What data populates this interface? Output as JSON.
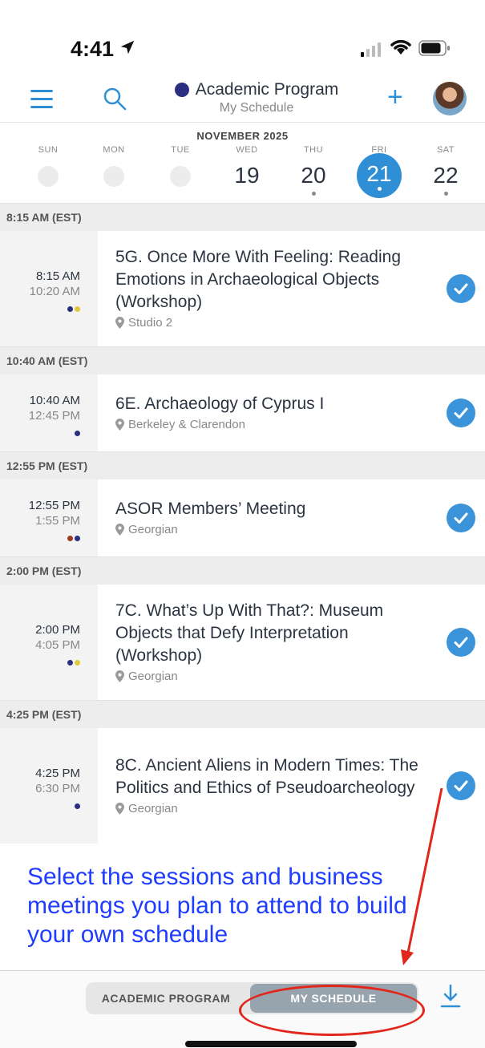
{
  "status": {
    "time": "4:41"
  },
  "header": {
    "title": "Academic Program",
    "subtitle": "My Schedule",
    "accent": "#2f8fd6",
    "dot_color": "#2a2f7f"
  },
  "calendar": {
    "month": "NOVEMBER 2025",
    "days": [
      {
        "name": "SUN",
        "num": ""
      },
      {
        "name": "MON",
        "num": ""
      },
      {
        "name": "TUE",
        "num": ""
      },
      {
        "name": "WED",
        "num": "19"
      },
      {
        "name": "THU",
        "num": "20"
      },
      {
        "name": "FRI",
        "num": "21"
      },
      {
        "name": "SAT",
        "num": "22"
      }
    ],
    "selected": "21"
  },
  "schedule": [
    {
      "section": "8:15 AM (EST)",
      "start": "8:15 AM",
      "end": "10:20 AM",
      "title": "5G. Once More With Feeling: Reading Emotions in Archaeological Objects (Workshop)",
      "place": "Studio 2",
      "dots": [
        "#2a2f7f",
        "#e3c73a"
      ]
    },
    {
      "section": "10:40 AM (EST)",
      "start": "10:40 AM",
      "end": "12:45 PM",
      "title": "6E. Archaeology of Cyprus I",
      "place": "Berkeley & Clarendon",
      "dots": [
        "#2a2f7f"
      ]
    },
    {
      "section": "12:55 PM (EST)",
      "start": "12:55 PM",
      "end": "1:55 PM",
      "title": "ASOR Members’ Meeting",
      "place": "Georgian",
      "dots": [
        "#9b3b24",
        "#2a2f7f"
      ]
    },
    {
      "section": "2:00 PM (EST)",
      "start": "2:00 PM",
      "end": "4:05 PM",
      "title": "7C. What’s Up With That?: Museum Objects that Defy Interpretation (Workshop)",
      "place": "Georgian",
      "dots": [
        "#2a2f7f",
        "#e3c73a"
      ]
    },
    {
      "section": "4:25 PM (EST)",
      "start": "4:25 PM",
      "end": "6:30 PM",
      "title": "8C. Ancient Aliens in Modern Times: The Politics and Ethics of Pseudoarcheology",
      "place": "Georgian",
      "dots": [
        "#2a2f7f"
      ]
    }
  ],
  "annotation": "Select the sessions and business meetings you plan to attend to build your own schedule",
  "bottom": {
    "tab_academic": "ACADEMIC PROGRAM",
    "tab_schedule": "MY SCHEDULE"
  }
}
